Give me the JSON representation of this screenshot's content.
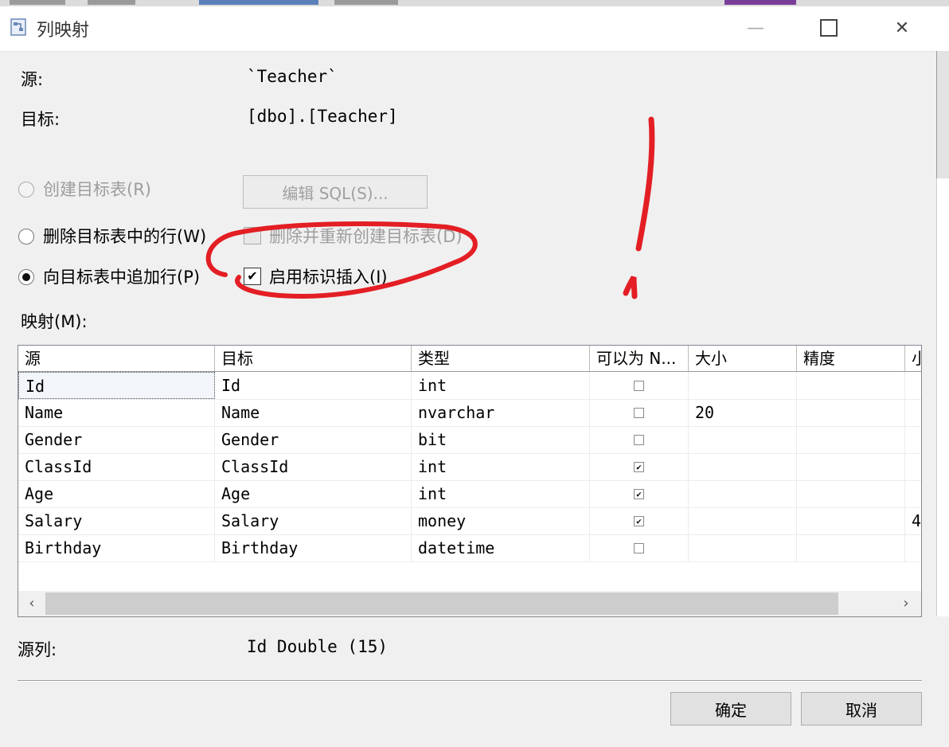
{
  "window": {
    "title": "列映射",
    "minimize_glyph": "—",
    "close_glyph": "✕"
  },
  "source": {
    "label": "源:",
    "value": "`Teacher`"
  },
  "target": {
    "label": "目标:",
    "value": "[dbo].[Teacher]"
  },
  "options": {
    "create_table": "创建目标表(R)",
    "edit_sql": "编辑 SQL(S)...",
    "delete_rows": "删除目标表中的行(W)",
    "drop_recreate": "删除并重新创建目标表(D)",
    "append_rows": "向目标表中追加行(P)",
    "enable_identity": "启用标识插入(I)",
    "check_mark": "✔"
  },
  "mappings_label": "映射(M):",
  "grid": {
    "headers": [
      "源",
      "目标",
      "类型",
      "可以为 N...",
      "大小",
      "精度",
      "小"
    ],
    "rows": [
      {
        "source": "Id",
        "target": "Id",
        "type": "int",
        "nullable": false,
        "size": "",
        "precision": "",
        "extra": ""
      },
      {
        "source": "Name",
        "target": "Name",
        "type": "nvarchar",
        "nullable": false,
        "size": "20",
        "precision": "",
        "extra": ""
      },
      {
        "source": "Gender",
        "target": "Gender",
        "type": "bit",
        "nullable": false,
        "size": "",
        "precision": "",
        "extra": ""
      },
      {
        "source": "ClassId",
        "target": "ClassId",
        "type": "int",
        "nullable": true,
        "size": "",
        "precision": "",
        "extra": ""
      },
      {
        "source": "Age",
        "target": "Age",
        "type": "int",
        "nullable": true,
        "size": "",
        "precision": "",
        "extra": ""
      },
      {
        "source": "Salary",
        "target": "Salary",
        "type": "money",
        "nullable": true,
        "size": "",
        "precision": "",
        "extra": "4"
      },
      {
        "source": "Birthday",
        "target": "Birthday",
        "type": "datetime",
        "nullable": false,
        "size": "",
        "precision": "",
        "extra": ""
      }
    ],
    "checked_glyph": "✔",
    "scroll_left": "‹",
    "scroll_right": "›"
  },
  "source_column": {
    "label": "源列:",
    "value": "Id Double (15)"
  },
  "buttons": {
    "ok": "确定",
    "cancel": "取消"
  },
  "colors": {
    "annotation": "#e31e24"
  }
}
